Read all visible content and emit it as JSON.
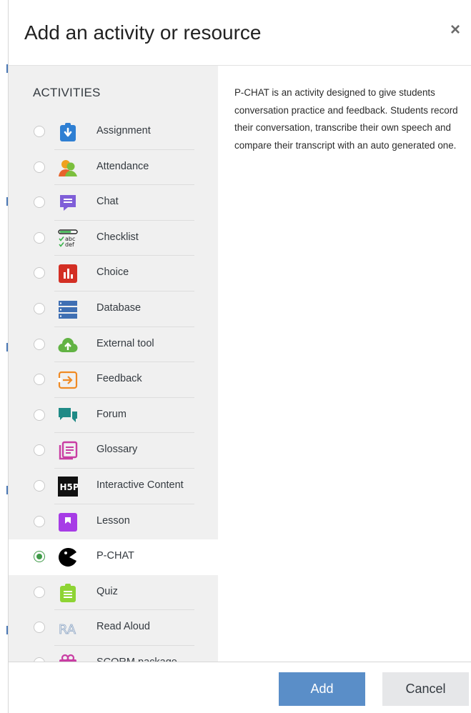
{
  "dialog": {
    "title": "Add an activity or resource",
    "close_symbol": "×"
  },
  "activities": {
    "section_title": "ACTIVITIES",
    "items": [
      {
        "label": "Assignment",
        "icon": "assignment-icon",
        "selected": false
      },
      {
        "label": "Attendance",
        "icon": "attendance-icon",
        "selected": false
      },
      {
        "label": "Chat",
        "icon": "chat-icon",
        "selected": false
      },
      {
        "label": "Checklist",
        "icon": "checklist-icon",
        "selected": false
      },
      {
        "label": "Choice",
        "icon": "choice-icon",
        "selected": false
      },
      {
        "label": "Database",
        "icon": "database-icon",
        "selected": false
      },
      {
        "label": "External tool",
        "icon": "external-tool-icon",
        "selected": false
      },
      {
        "label": "Feedback",
        "icon": "feedback-icon",
        "selected": false
      },
      {
        "label": "Forum",
        "icon": "forum-icon",
        "selected": false
      },
      {
        "label": "Glossary",
        "icon": "glossary-icon",
        "selected": false
      },
      {
        "label": "Interactive Content",
        "icon": "h5p-icon",
        "selected": false
      },
      {
        "label": "Lesson",
        "icon": "lesson-icon",
        "selected": false
      },
      {
        "label": "P-CHAT",
        "icon": "pchat-icon",
        "selected": true
      },
      {
        "label": "Quiz",
        "icon": "quiz-icon",
        "selected": false
      },
      {
        "label": "Read Aloud",
        "icon": "read-aloud-icon",
        "selected": false
      },
      {
        "label": "SCORM package",
        "icon": "scorm-icon",
        "selected": false
      }
    ]
  },
  "description": "P-CHAT is an activity designed to give students conversation practice and feedback. Students record their conversation, transcribe their own speech and compare their transcript with an auto generated one.",
  "footer": {
    "add_label": "Add",
    "cancel_label": "Cancel"
  },
  "colors": {
    "accent": "#5a8ec8",
    "selected_radio": "#3f9a48"
  }
}
